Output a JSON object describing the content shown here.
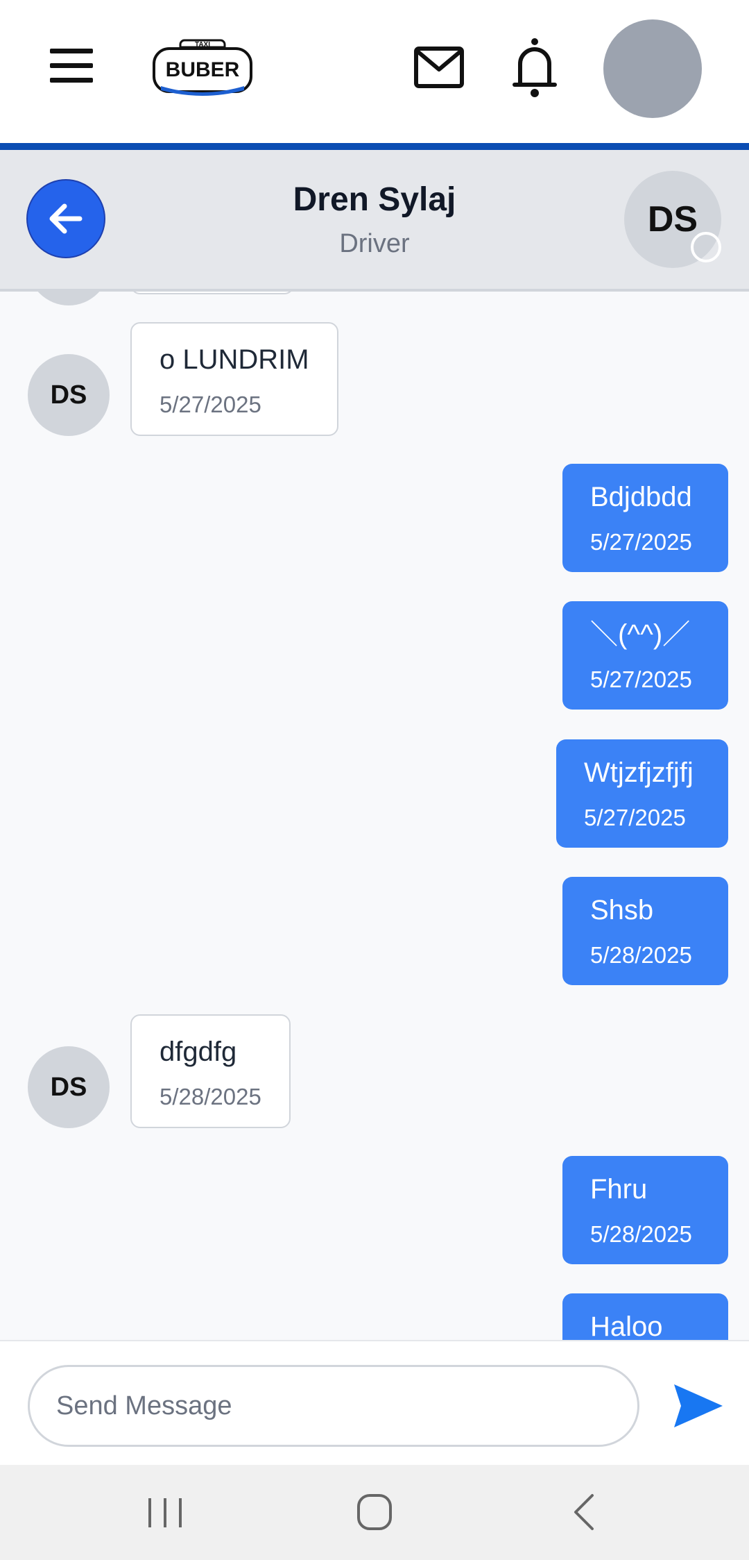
{
  "app": {
    "logo_text": "BUBER",
    "logo_badge": "TAXI"
  },
  "icons": {
    "menu": "hamburger-icon",
    "mail": "mail-icon",
    "notifications": "bell-icon",
    "back": "arrow-left-icon",
    "send": "send-icon"
  },
  "colors": {
    "primary": "#2563eb",
    "outgoing_bubble": "#3b82f6",
    "accent_bar": "#0b4db3",
    "header_bg": "#e5e7eb"
  },
  "chat_header": {
    "name": "Dren Sylaj",
    "role": "Driver",
    "initials": "DS"
  },
  "messages": [
    {
      "direction": "in",
      "initials": "DS",
      "text": "o LUNDRIM",
      "time": "5/27/2025"
    },
    {
      "direction": "out",
      "text": "Bdjdbdd",
      "time": "5/27/2025"
    },
    {
      "direction": "out",
      "text": "＼(^^)／",
      "time": "5/27/2025"
    },
    {
      "direction": "out",
      "text": "Wtjzfjzfjfj",
      "time": "5/27/2025"
    },
    {
      "direction": "out",
      "text": "Shsb",
      "time": "5/28/2025"
    },
    {
      "direction": "in",
      "initials": "DS",
      "text": "dfgdfg",
      "time": "5/28/2025"
    },
    {
      "direction": "out",
      "text": "Fhru",
      "time": "5/28/2025"
    },
    {
      "direction": "out",
      "text": "Haloo",
      "time": ""
    }
  ],
  "composer": {
    "placeholder": "Send Message",
    "value": ""
  }
}
